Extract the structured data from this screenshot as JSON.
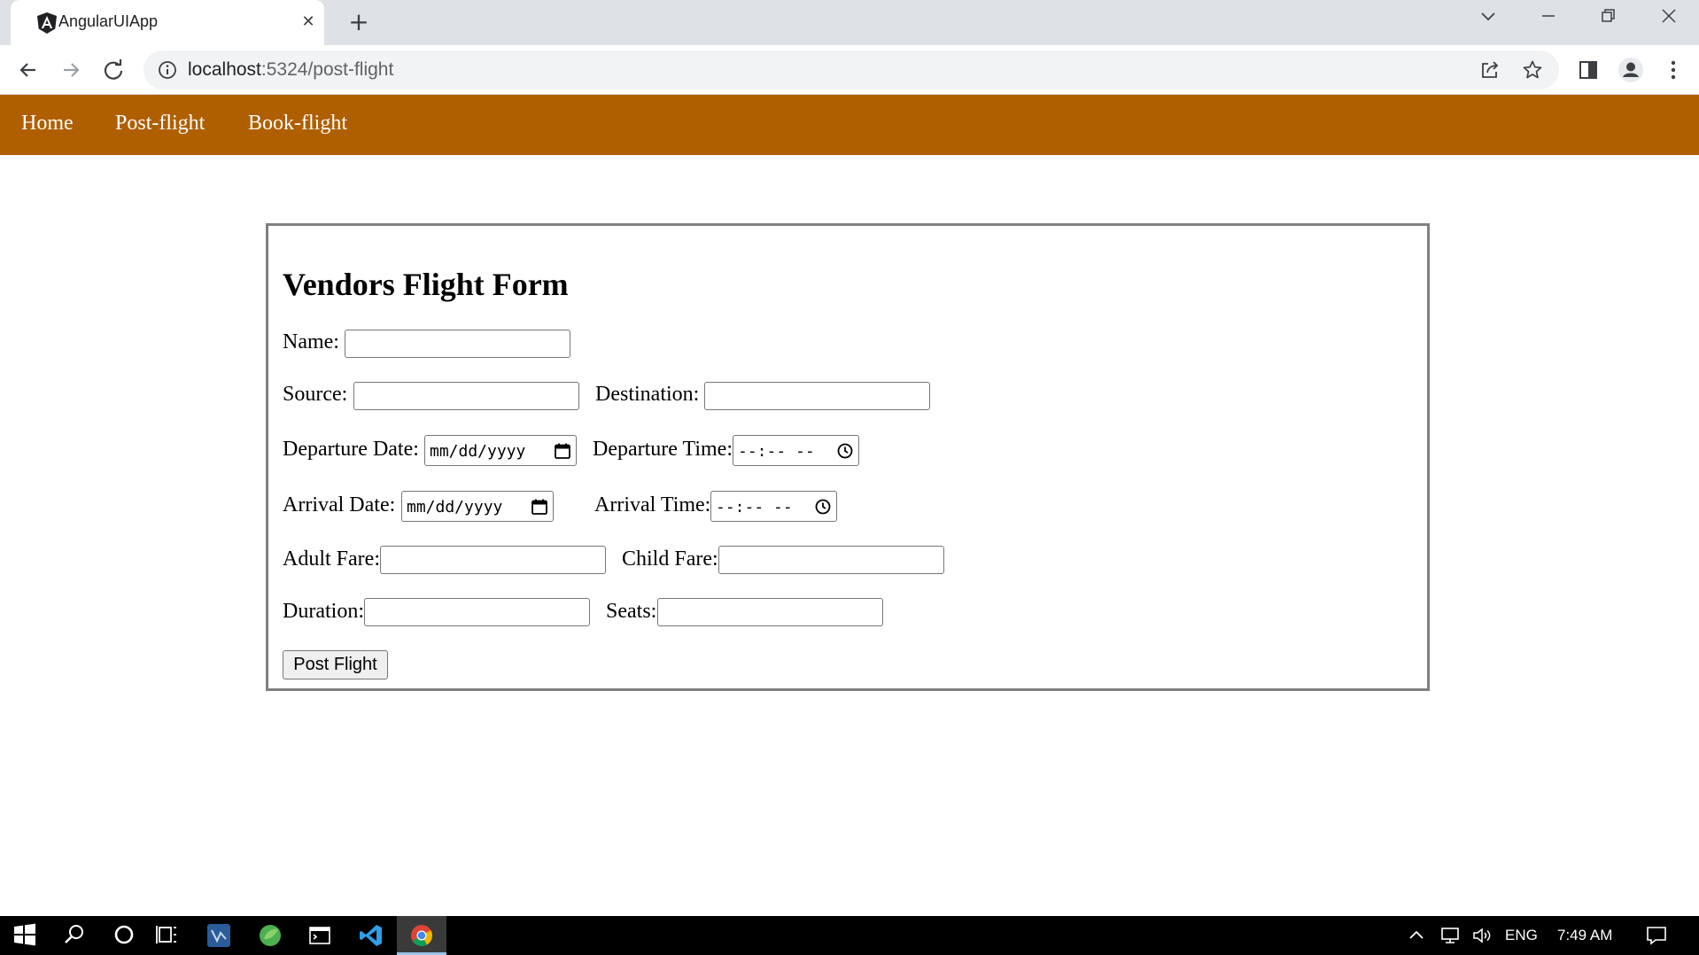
{
  "browser": {
    "tab_title": "AngularUIApp",
    "tab_close": "✕",
    "new_tab": "+",
    "url_host": "localhost",
    "url_path": ":5324/post-flight"
  },
  "nav": {
    "home": "Home",
    "post_flight": "Post-flight",
    "book_flight": "Book-flight"
  },
  "form": {
    "title": "Vendors Flight Form",
    "name_label": "Name:",
    "source_label": "Source:",
    "destination_label": "Destination:",
    "departure_date_label": "Departure Date:",
    "departure_time_label": "Departure Time:",
    "arrival_date_label": "Arrival Date:",
    "arrival_time_label": "Arrival Time:",
    "adult_fare_label": "Adult Fare:",
    "child_fare_label": "Child Fare:",
    "duration_label": "Duration:",
    "seats_label": "Seats:",
    "date_placeholder": "mm/dd/yyyy",
    "time_placeholder": "--:-- --",
    "submit_label": "Post Flight"
  },
  "taskbar": {
    "language": "ENG",
    "clock": "7:49 AM"
  },
  "colors": {
    "navbar": "#af5f00",
    "form_border": "#808080"
  }
}
